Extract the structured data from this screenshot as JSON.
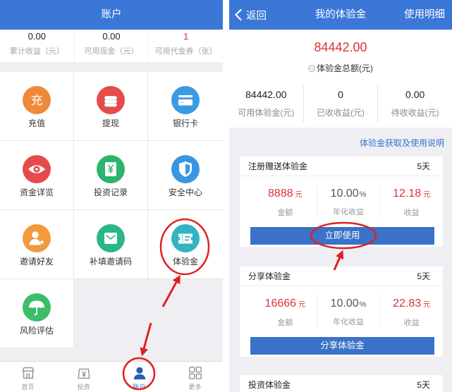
{
  "colors": {
    "header_blue": "#3a77d6",
    "button_blue": "#3a72c8",
    "link_blue": "#3a72c8",
    "value_red": "#dc3139",
    "annotation_red": "#e0201e"
  },
  "account": {
    "header_title": "账户",
    "stats": [
      {
        "value": "0.00",
        "label": "累计收益（元）"
      },
      {
        "value": "0.00",
        "label": "可用现金（元）"
      },
      {
        "value": "1",
        "label": "可用代金券（张）"
      }
    ],
    "grid": [
      {
        "label": "充值",
        "icon": "recharge-icon",
        "glyph": "充",
        "color": "#f0883a"
      },
      {
        "label": "提现",
        "icon": "coin-stack-icon",
        "color": "#e84b4b"
      },
      {
        "label": "银行卡",
        "icon": "bank-card-icon",
        "color": "#3a9be2"
      },
      {
        "label": "资金详览",
        "icon": "eye-icon",
        "color": "#e64a4a"
      },
      {
        "label": "投资记录",
        "icon": "document-yuan-icon",
        "color": "#2db46c"
      },
      {
        "label": "安全中心",
        "icon": "shield-icon",
        "color": "#3a96e0"
      },
      {
        "label": "邀请好友",
        "icon": "invite-person-icon",
        "color": "#f39a3d"
      },
      {
        "label": "补填邀请码",
        "icon": "invite-code-icon",
        "color": "#2bb58a"
      },
      {
        "label": "体验金",
        "icon": "ticket-icon",
        "color": "#33b4c0"
      },
      {
        "label": "风险评估",
        "icon": "umbrella-icon",
        "color": "#3cbd6a"
      }
    ],
    "tabs": [
      {
        "label": "首页",
        "icon": "home-store-icon",
        "active": false
      },
      {
        "label": "投资",
        "icon": "invest-icon",
        "active": false
      },
      {
        "label": "账户",
        "icon": "account-icon",
        "active": true
      },
      {
        "label": "更多",
        "icon": "more-grid-icon",
        "active": false
      }
    ]
  },
  "trial": {
    "back_label": "返回",
    "header_title": "我的体验金",
    "detail_link": "使用明细",
    "total_value": "84442.00",
    "total_label": "体验金总额(元)",
    "stats": [
      {
        "value": "84442.00",
        "label": "可用体验金(元)"
      },
      {
        "value": "0",
        "label": "已收收益(元)"
      },
      {
        "value": "0.00",
        "label": "待收收益(元)"
      }
    ],
    "guide_link": "体验金获取及使用说明",
    "cards": [
      {
        "title": "注册赠送体验金",
        "days": "5天",
        "amount": "8888",
        "amount_unit": "元",
        "amount_label": "金额",
        "rate": "10.00",
        "rate_unit": "%",
        "rate_label": "年化收益",
        "income": "12.18",
        "income_unit": "元",
        "income_label": "收益",
        "button": "立即使用"
      },
      {
        "title": "分享体验金",
        "days": "5天",
        "amount": "16666",
        "amount_unit": "元",
        "amount_label": "金额",
        "rate": "10.00",
        "rate_unit": "%",
        "rate_label": "年化收益",
        "income": "22.83",
        "income_unit": "元",
        "income_label": "收益",
        "button": "分享体验金"
      },
      {
        "title": "投资体验金",
        "days": "5天"
      }
    ]
  }
}
